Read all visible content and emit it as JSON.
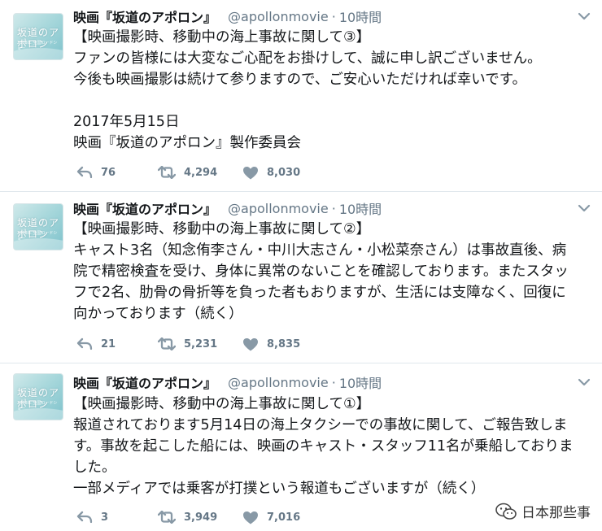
{
  "account": {
    "display_name": "映画『坂道のアポロン』",
    "handle": "@apollonmovie",
    "separator": "·",
    "avatar_text": "坂道のアポロン",
    "avatar_sub": "2018年 全国ロードショー"
  },
  "tweets": [
    {
      "time": "10時間",
      "lines": [
        "【映画撮影時、移動中の海上事故に関して③】",
        "ファンの皆様には大変なご心配をお掛けして、誠に申し訳ございません。",
        "今後も映画撮影は続けて参りますので、ご安心いただければ幸いです。",
        "",
        "2017年5月15日",
        "映画『坂道のアポロン』製作委員会"
      ],
      "replies": "76",
      "retweets": "4,294",
      "likes": "8,030"
    },
    {
      "time": "10時間",
      "lines": [
        "【映画撮影時、移動中の海上事故に関して②】",
        "キャスト3名（知念侑李さん・中川大志さん・小松菜奈さん）は事故直後、病",
        "院で精密検査を受け、身体に異常のないことを確認しております。またスタッ",
        "フで2名、肋骨の骨折等を負った者もおりますが、生活には支障なく、回復に",
        "向かっております（続く）"
      ],
      "replies": "21",
      "retweets": "5,231",
      "likes": "8,835"
    },
    {
      "time": "10時間",
      "lines": [
        "【映画撮影時、移動中の海上事故に関して①】",
        "報道されております5月14日の海上タクシーでの事故に関して、ご報告致しま",
        "す。事故を起こした船には、映画のキャスト・スタッフ11名が乗船しておりま",
        "した。",
        "一部メディアでは乗客が打撲という報道もございますが（続く）"
      ],
      "replies": "3",
      "retweets": "3,949",
      "likes": "7,016"
    }
  ],
  "watermark": {
    "text": "日本那些事"
  },
  "colors": {
    "text": "#14171a",
    "muted": "#657786",
    "divider": "#e1e8ed"
  },
  "icons": [
    "reply-icon",
    "retweet-icon",
    "like-icon",
    "chevron-down-icon",
    "wechat-icon"
  ]
}
